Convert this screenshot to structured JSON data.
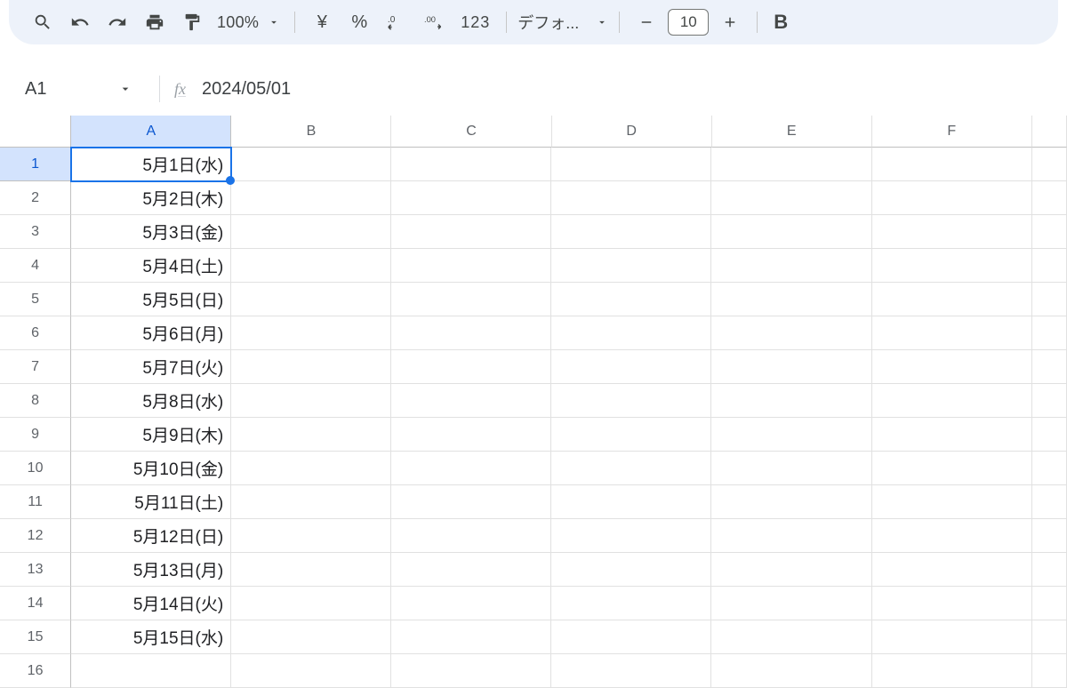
{
  "toolbar": {
    "zoom": "100%",
    "currency_symbol": "¥",
    "percent_symbol": "%",
    "format123": "123",
    "font_name": "デフォ...",
    "font_size": "10",
    "bold_label": "B"
  },
  "name_box": {
    "ref": "A1"
  },
  "formula_bar": {
    "fx_symbol": "fx",
    "value": "2024/05/01"
  },
  "columns": [
    "A",
    "B",
    "C",
    "D",
    "E",
    "F"
  ],
  "selected_column_index": 0,
  "selected_row_index": 0,
  "rows": [
    {
      "n": "1",
      "a": "5月1日(水)"
    },
    {
      "n": "2",
      "a": "5月2日(木)"
    },
    {
      "n": "3",
      "a": "5月3日(金)"
    },
    {
      "n": "4",
      "a": "5月4日(土)"
    },
    {
      "n": "5",
      "a": "5月5日(日)"
    },
    {
      "n": "6",
      "a": "5月6日(月)"
    },
    {
      "n": "7",
      "a": "5月7日(火)"
    },
    {
      "n": "8",
      "a": "5月8日(水)"
    },
    {
      "n": "9",
      "a": "5月9日(木)"
    },
    {
      "n": "10",
      "a": "5月10日(金)"
    },
    {
      "n": "11",
      "a": "5月11日(土)"
    },
    {
      "n": "12",
      "a": "5月12日(日)"
    },
    {
      "n": "13",
      "a": "5月13日(月)"
    },
    {
      "n": "14",
      "a": "5月14日(火)"
    },
    {
      "n": "15",
      "a": "5月15日(水)"
    },
    {
      "n": "16",
      "a": ""
    }
  ]
}
